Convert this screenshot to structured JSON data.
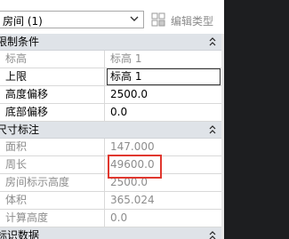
{
  "type_selector": {
    "value": "房间 (1)"
  },
  "edit_type": {
    "label": "编辑类型"
  },
  "groups": [
    {
      "name": "限制条件",
      "rows": [
        {
          "name": "标高",
          "value": "标高 1",
          "readonly": true
        },
        {
          "name": "上限",
          "value": "标高 1",
          "readonly": false,
          "editing": true
        },
        {
          "name": "高度偏移",
          "value": "2500.0",
          "readonly": false
        },
        {
          "name": "底部偏移",
          "value": "0.0",
          "readonly": false
        }
      ]
    },
    {
      "name": "尺寸标注",
      "rows": [
        {
          "name": "面积",
          "value": "147.000",
          "readonly": true
        },
        {
          "name": "周长",
          "value": "49600.0",
          "readonly": true
        },
        {
          "name": "房间标示高度",
          "value": "2500.0",
          "readonly": true
        },
        {
          "name": "体积",
          "value": "365.024",
          "readonly": true
        },
        {
          "name": "计算高度",
          "value": "0.0",
          "readonly": true
        }
      ]
    },
    {
      "name": "标识数据",
      "rows": []
    }
  ],
  "colors": {
    "group_header": "#dfe3e8",
    "highlight": "#e0372e",
    "readonly_text": "#8d8d8d"
  }
}
